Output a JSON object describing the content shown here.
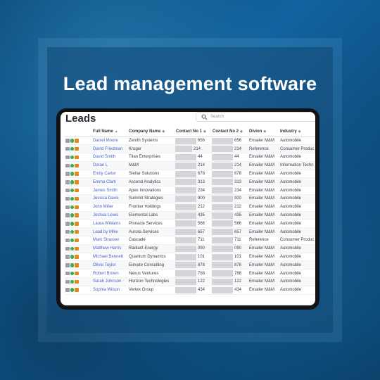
{
  "headline": "Lead management software",
  "app": {
    "title": "Leads",
    "search_placeholder": "Search"
  },
  "table": {
    "columns": [
      "",
      "Full Name",
      "Company Name",
      "Contact No 1",
      "Contact No 2",
      "Divion",
      "Industry"
    ],
    "sort_icons": {
      "active": "▲",
      "inactive": "◆"
    },
    "rows": [
      {
        "name": "Daniel Moore",
        "company": "Zenith Systems",
        "c1": "656",
        "c2": "656",
        "division": "Emailer M&M",
        "industry": "Automobile"
      },
      {
        "name": "David Friedman",
        "company": "Kruger",
        "c1": "214",
        "c2": "214",
        "division": "Reference",
        "industry": "Consumer Produc"
      },
      {
        "name": "David Smith",
        "company": "Titan Enterprises",
        "c1": "44",
        "c2": "44",
        "division": "Emailer M&M",
        "industry": "Automobile"
      },
      {
        "name": "Doran L",
        "company": "M&M",
        "c1": "214",
        "c2": "214",
        "division": "Emailer M&M",
        "industry": "Information Techn"
      },
      {
        "name": "Emily Carter",
        "company": "Stellar Solutions",
        "c1": "678",
        "c2": "678",
        "division": "Emailer M&M",
        "industry": "Automobile"
      },
      {
        "name": "Emma Clark",
        "company": "Ascend Analytics",
        "c1": "313",
        "c2": "313",
        "division": "Emailer M&M",
        "industry": "Automobile"
      },
      {
        "name": "James Smith",
        "company": "Apex Innovations",
        "c1": "234",
        "c2": "234",
        "division": "Emailer M&M",
        "industry": "Automobile"
      },
      {
        "name": "Jessica Davis",
        "company": "Summit Strategies",
        "c1": "900",
        "c2": "900",
        "division": "Emailer M&M",
        "industry": "Automobile"
      },
      {
        "name": "John Miller",
        "company": "Frontier Holdings",
        "c1": "212",
        "c2": "212",
        "division": "Emailer M&M",
        "industry": "Automobile"
      },
      {
        "name": "Joshua Lewis",
        "company": "Elemental Labs",
        "c1": "435",
        "c2": "435",
        "division": "Emailer M&M",
        "industry": "Automobile"
      },
      {
        "name": "Laura Williams",
        "company": "Pinnacle Services",
        "c1": "566",
        "c2": "566",
        "division": "Emailer M&M",
        "industry": "Automobile"
      },
      {
        "name": "Lead by Mike",
        "company": "Aurora Services",
        "c1": "657",
        "c2": "657",
        "division": "Emailer M&M",
        "industry": "Automobile"
      },
      {
        "name": "Mark Strasser",
        "company": "Cascade",
        "c1": "711",
        "c2": "711",
        "division": "Reference",
        "industry": "Consumer Produc"
      },
      {
        "name": "Matthew Harris",
        "company": "Radiant Energy",
        "c1": "090",
        "c2": "090",
        "division": "Emailer M&M",
        "industry": "Automobile"
      },
      {
        "name": "Michael Bennett",
        "company": "Quantum Dynamics",
        "c1": "101",
        "c2": "101",
        "division": "Emailer M&M",
        "industry": "Automobile"
      },
      {
        "name": "Olivia Taylor",
        "company": "Elevate Consulting",
        "c1": "878",
        "c2": "878",
        "division": "Emailer M&M",
        "industry": "Automobile"
      },
      {
        "name": "Robert Brown",
        "company": "Nexus Ventures",
        "c1": "788",
        "c2": "788",
        "division": "Emailer M&M",
        "industry": "Automobile"
      },
      {
        "name": "Sarah Johnson",
        "company": "Horizon Technologies",
        "c1": "122",
        "c2": "122",
        "division": "Emailer M&M",
        "industry": "Automobile"
      },
      {
        "name": "Sophia Wilson",
        "company": "Vertex Group",
        "c1": "434",
        "c2": "434",
        "division": "Emailer M&M",
        "industry": "Automobile"
      }
    ]
  },
  "colors": {
    "link": "#4a64c9",
    "icon_doc": "#9aa0a8",
    "icon_info": "#3ea84a",
    "icon_case": "#e08a1e",
    "redaction": "#d3d5d8"
  }
}
